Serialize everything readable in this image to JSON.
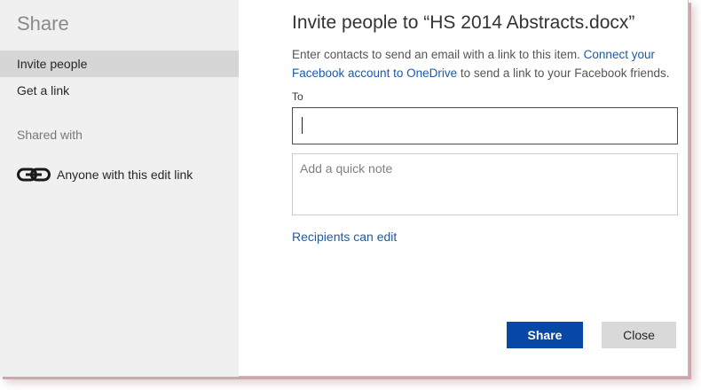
{
  "sidebar": {
    "title": "Share",
    "items": [
      {
        "label": "Invite people",
        "active": true
      },
      {
        "label": "Get a link",
        "active": false
      }
    ],
    "shared_with_heading": "Shared with",
    "shared_entry": {
      "icon": "link-icon",
      "label": "Anyone with this edit link"
    }
  },
  "main": {
    "title": "Invite people to “HS 2014 Abstracts.docx”",
    "description_prefix": "Enter contacts to send an email with a link to this item.",
    "facebook_link": "Connect your Facebook account to OneDrive",
    "description_suffix": "to send a link to your Facebook friends.",
    "to_label": "To",
    "to_value": "",
    "note_placeholder": "Add a quick note",
    "recipients_link": "Recipients can edit",
    "share_button": "Share",
    "close_button": "Close"
  },
  "colors": {
    "accent": "#0747a6",
    "link": "#1b5aa8",
    "sidebar_bg": "#f0f0f0",
    "active_item_bg": "#d6d6d6"
  }
}
